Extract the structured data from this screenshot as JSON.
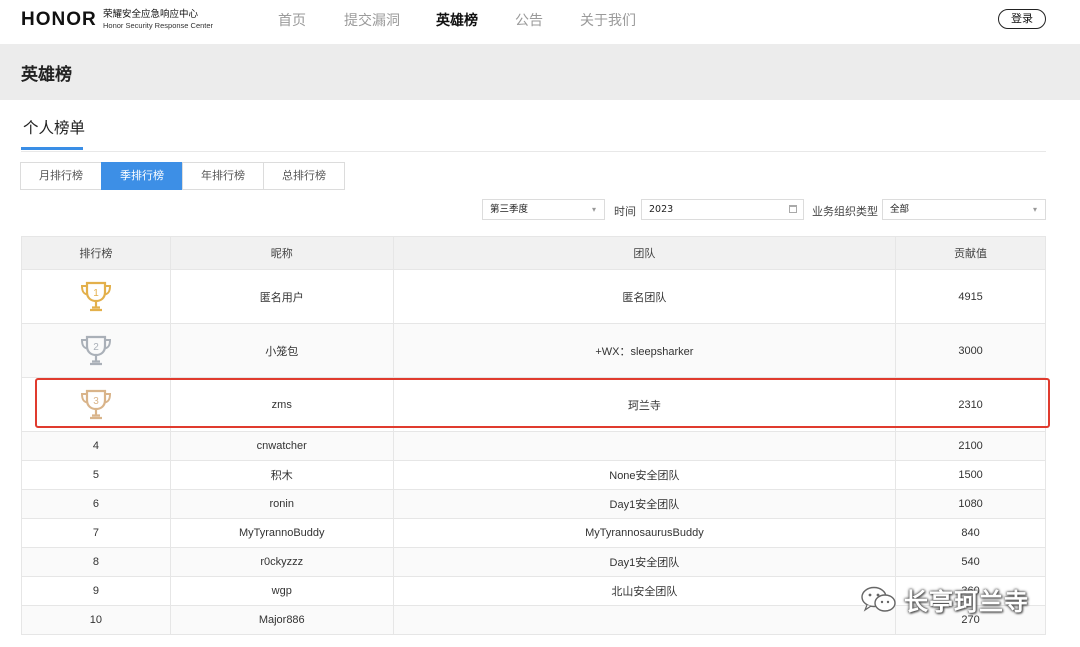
{
  "header": {
    "brand": "HONOR",
    "brand_sub_zh": "荣耀安全应急响应中心",
    "brand_sub_en": "Honor Security Response Center",
    "nav": [
      {
        "label": "首页"
      },
      {
        "label": "提交漏洞"
      },
      {
        "label": "英雄榜"
      },
      {
        "label": "公告"
      },
      {
        "label": "关于我们"
      }
    ],
    "active_nav": "英雄榜",
    "login_label": "登录"
  },
  "page": {
    "title": "英雄榜",
    "section_title": "个人榜单"
  },
  "tabs": [
    {
      "label": "月排行榜"
    },
    {
      "label": "季排行榜"
    },
    {
      "label": "年排行榜"
    },
    {
      "label": "总排行榜"
    }
  ],
  "active_tab": "季排行榜",
  "filters": {
    "quarter_value": "第三季度",
    "time_label": "时间",
    "year_value": "2023",
    "org_type_label": "业务组织类型",
    "org_type_value": "全部"
  },
  "table": {
    "headers": [
      "排行榜",
      "昵称",
      "团队",
      "贡献值"
    ],
    "rows": [
      {
        "rank": "1",
        "nickname": "匿名用户",
        "team": "匿名团队",
        "score": "4915"
      },
      {
        "rank": "2",
        "nickname": "小笼包",
        "team": "+WX：sleepsharker",
        "score": "3000"
      },
      {
        "rank": "3",
        "nickname": "zms",
        "team": "珂兰寺",
        "score": "2310"
      },
      {
        "rank": "4",
        "nickname": "cnwatcher",
        "team": "",
        "score": "2100"
      },
      {
        "rank": "5",
        "nickname": "积木",
        "team": "None安全团队",
        "score": "1500"
      },
      {
        "rank": "6",
        "nickname": "ronin",
        "team": "Day1安全团队",
        "score": "1080"
      },
      {
        "rank": "7",
        "nickname": "MyTyrannoBuddy",
        "team": "MyTyrannosaurusBuddy",
        "score": "840"
      },
      {
        "rank": "8",
        "nickname": "r0ckyzzz",
        "team": "Day1安全团队",
        "score": "540"
      },
      {
        "rank": "9",
        "nickname": "wgp",
        "team": "北山安全团队",
        "score": "360"
      },
      {
        "rank": "10",
        "nickname": "Major886",
        "team": "",
        "score": "270"
      }
    ]
  },
  "colors": {
    "accent": "#3d8fe6",
    "gold": "#e3b04b",
    "silver": "#aab0b8",
    "bronze": "#d9b48a",
    "highlight_border": "#e03b2e"
  },
  "icons": {
    "rank_1": "gold-trophy-icon",
    "rank_2": "silver-trophy-icon",
    "rank_3": "bronze-trophy-icon",
    "watermark": "wechat-icon"
  },
  "watermark": {
    "text": "长亭珂兰寺"
  }
}
